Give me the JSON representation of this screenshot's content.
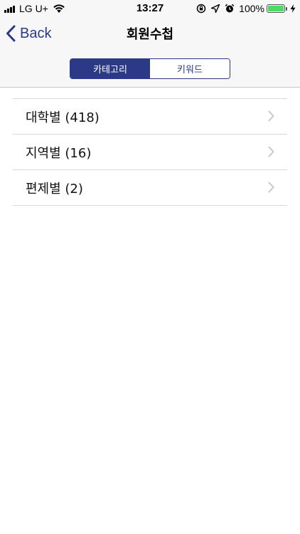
{
  "status_bar": {
    "carrier": "LG U+",
    "time": "13:27",
    "battery_percent": "100%",
    "battery_level": 1.0,
    "battery_color": "#4cd964",
    "icons": [
      "signal-bars-icon",
      "wifi-icon",
      "orientation-lock-icon",
      "location-arrow-icon",
      "alarm-clock-icon",
      "battery-icon",
      "charging-bolt-icon"
    ]
  },
  "nav": {
    "back_label": "Back",
    "title": "회원수첩",
    "back_icon": "chevron-left-icon"
  },
  "segments": [
    {
      "label": "카테고리",
      "selected": true
    },
    {
      "label": "키워드",
      "selected": false
    }
  ],
  "list": {
    "items": [
      {
        "label": "대학별 (418)"
      },
      {
        "label": "지역별 (16)"
      },
      {
        "label": "편제별 (2)"
      }
    ]
  },
  "colors": {
    "accent": "#2c3987",
    "bar_background": "#f7f7f7",
    "separator": "#d9d9dc",
    "chevron": "#c7c7cc"
  }
}
